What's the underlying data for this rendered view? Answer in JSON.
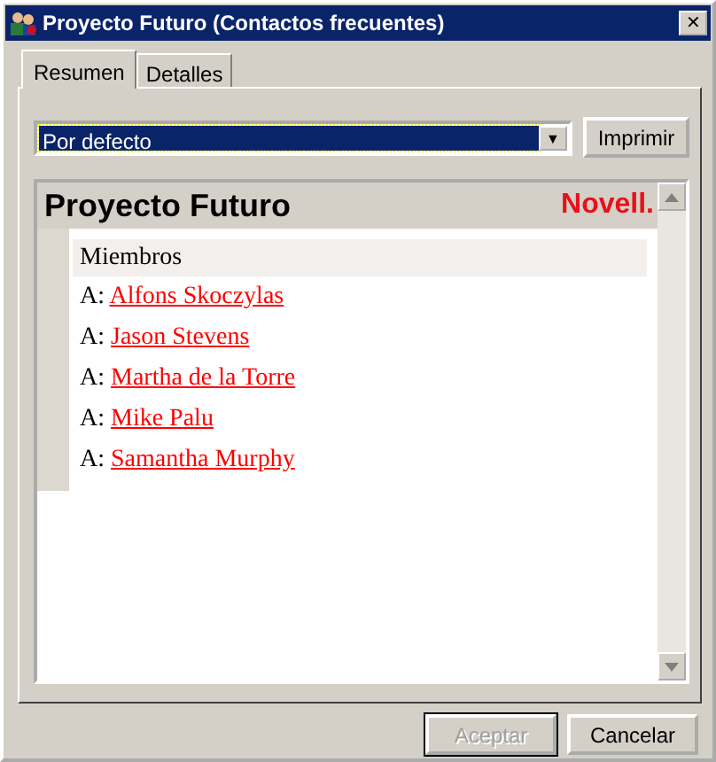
{
  "window": {
    "title": "Proyecto Futuro (Contactos frecuentes)",
    "close": "✕"
  },
  "tabs": [
    {
      "label": "Resumen",
      "selected": true
    },
    {
      "label": "Detalles",
      "selected": false
    }
  ],
  "view_select": {
    "value": "Por defecto",
    "arrow": "▼"
  },
  "print_button": {
    "label": "Imprimir",
    "disabled": false
  },
  "summary": {
    "title": "Proyecto Futuro",
    "logo": "Novell.",
    "section": "Miembros",
    "members": [
      {
        "prefix": "A:",
        "name": "Alfons Skoczylas"
      },
      {
        "prefix": "A:",
        "name": "Jason Stevens"
      },
      {
        "prefix": "A:",
        "name": "Martha de la Torre"
      },
      {
        "prefix": "A:",
        "name": "Mike Palu"
      },
      {
        "prefix": "A:",
        "name": "Samantha Murphy"
      }
    ]
  },
  "buttons": [
    {
      "label": "Aceptar",
      "disabled": true
    },
    {
      "label": "Cancelar",
      "disabled": false
    }
  ]
}
